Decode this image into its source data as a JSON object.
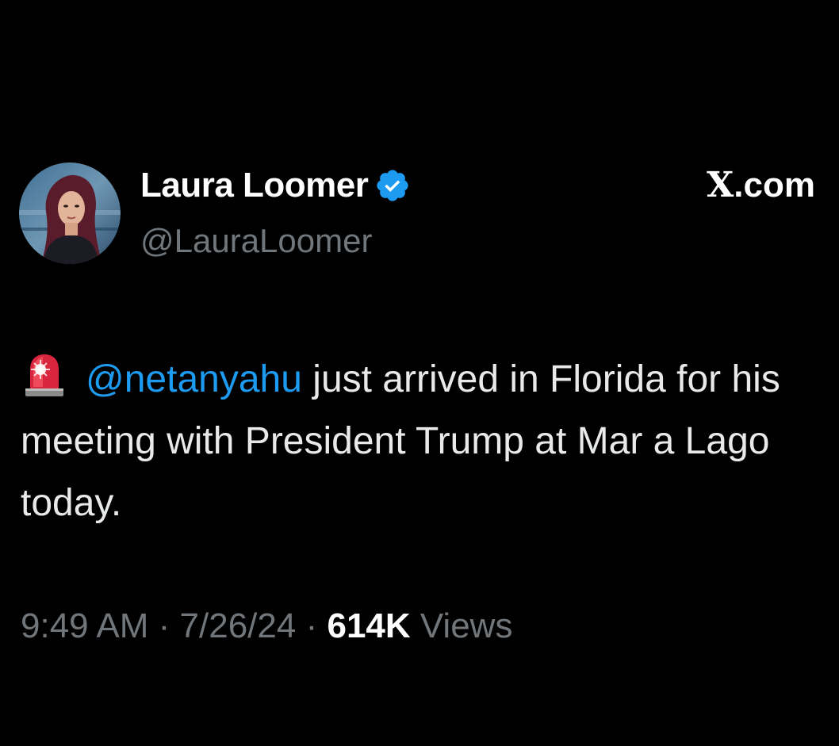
{
  "author": {
    "display_name": "Laura Loomer",
    "handle": "@LauraLoomer",
    "verified_icon": "verified-badge-icon",
    "avatar_icon": "profile-photo"
  },
  "site": {
    "glyph": "X",
    "suffix": ".com"
  },
  "tweet": {
    "emoji_icon": "police-siren-icon",
    "mention": "@netanyahu",
    "text_after_mention": " just arrived in Florida for his meeting with President Trump at Mar a Lago today."
  },
  "meta": {
    "time": "9:49 AM",
    "separator": " · ",
    "date": "7/26/24",
    "views_count": "614K",
    "views_label": " Views"
  },
  "colors": {
    "background": "#000000",
    "link": "#1d9bf0",
    "secondary_text": "#71767b",
    "verified_badge": "#1d9bf0"
  }
}
